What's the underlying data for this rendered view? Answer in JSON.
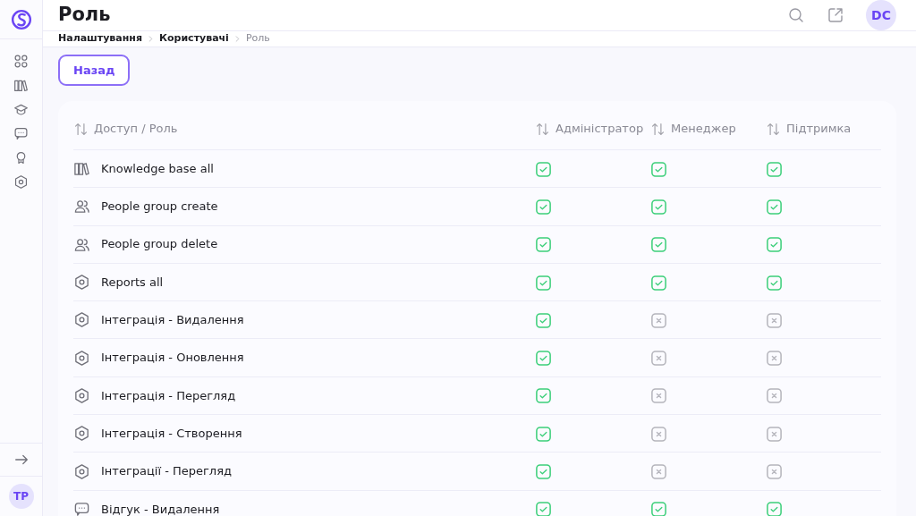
{
  "sidebar": {
    "items": [
      {
        "kind": "grid"
      },
      {
        "kind": "books"
      },
      {
        "kind": "cap"
      },
      {
        "kind": "chat"
      },
      {
        "kind": "award"
      },
      {
        "kind": "hexagon"
      }
    ],
    "user_initials": "TP"
  },
  "header": {
    "title": "Роль",
    "user_initials": "DC"
  },
  "breadcrumbs": [
    {
      "label": "Налаштування",
      "current": false
    },
    {
      "label": "Користувачі",
      "current": false
    },
    {
      "label": "Роль",
      "current": true
    }
  ],
  "back_button": "Назад",
  "table": {
    "columns": [
      "Доступ / Роль",
      "Адміністратор",
      "Менеджер",
      "Підтримка"
    ],
    "rows": [
      {
        "kind": "books",
        "name": "Knowledge base all",
        "access": [
          {
            "checked": true
          },
          {
            "checked": true
          },
          {
            "checked": true
          }
        ]
      },
      {
        "kind": "people",
        "name": "People group create",
        "access": [
          {
            "checked": true
          },
          {
            "checked": true
          },
          {
            "checked": true
          }
        ]
      },
      {
        "kind": "people",
        "name": "People group delete",
        "access": [
          {
            "checked": true
          },
          {
            "checked": true
          },
          {
            "checked": true
          }
        ]
      },
      {
        "kind": "hexagon",
        "name": "Reports all",
        "access": [
          {
            "checked": true
          },
          {
            "checked": true
          },
          {
            "checked": true
          }
        ]
      },
      {
        "kind": "hexagon",
        "name": "Інтеграція - Видалення",
        "access": [
          {
            "checked": true
          },
          {
            "checked": false
          },
          {
            "checked": false
          }
        ]
      },
      {
        "kind": "hexagon",
        "name": "Інтеграція - Оновлення",
        "access": [
          {
            "checked": true
          },
          {
            "checked": false
          },
          {
            "checked": false
          }
        ]
      },
      {
        "kind": "hexagon",
        "name": "Інтеграція - Перегляд",
        "access": [
          {
            "checked": true
          },
          {
            "checked": false
          },
          {
            "checked": false
          }
        ]
      },
      {
        "kind": "hexagon",
        "name": "Інтеграція - Створення",
        "access": [
          {
            "checked": true
          },
          {
            "checked": false
          },
          {
            "checked": false
          }
        ]
      },
      {
        "kind": "hexagon",
        "name": "Інтеграції - Перегляд",
        "access": [
          {
            "checked": true
          },
          {
            "checked": false
          },
          {
            "checked": false
          }
        ]
      },
      {
        "kind": "chat",
        "name": "Відгук - Видалення",
        "access": [
          {
            "checked": true
          },
          {
            "checked": true
          },
          {
            "checked": true
          }
        ]
      }
    ]
  }
}
